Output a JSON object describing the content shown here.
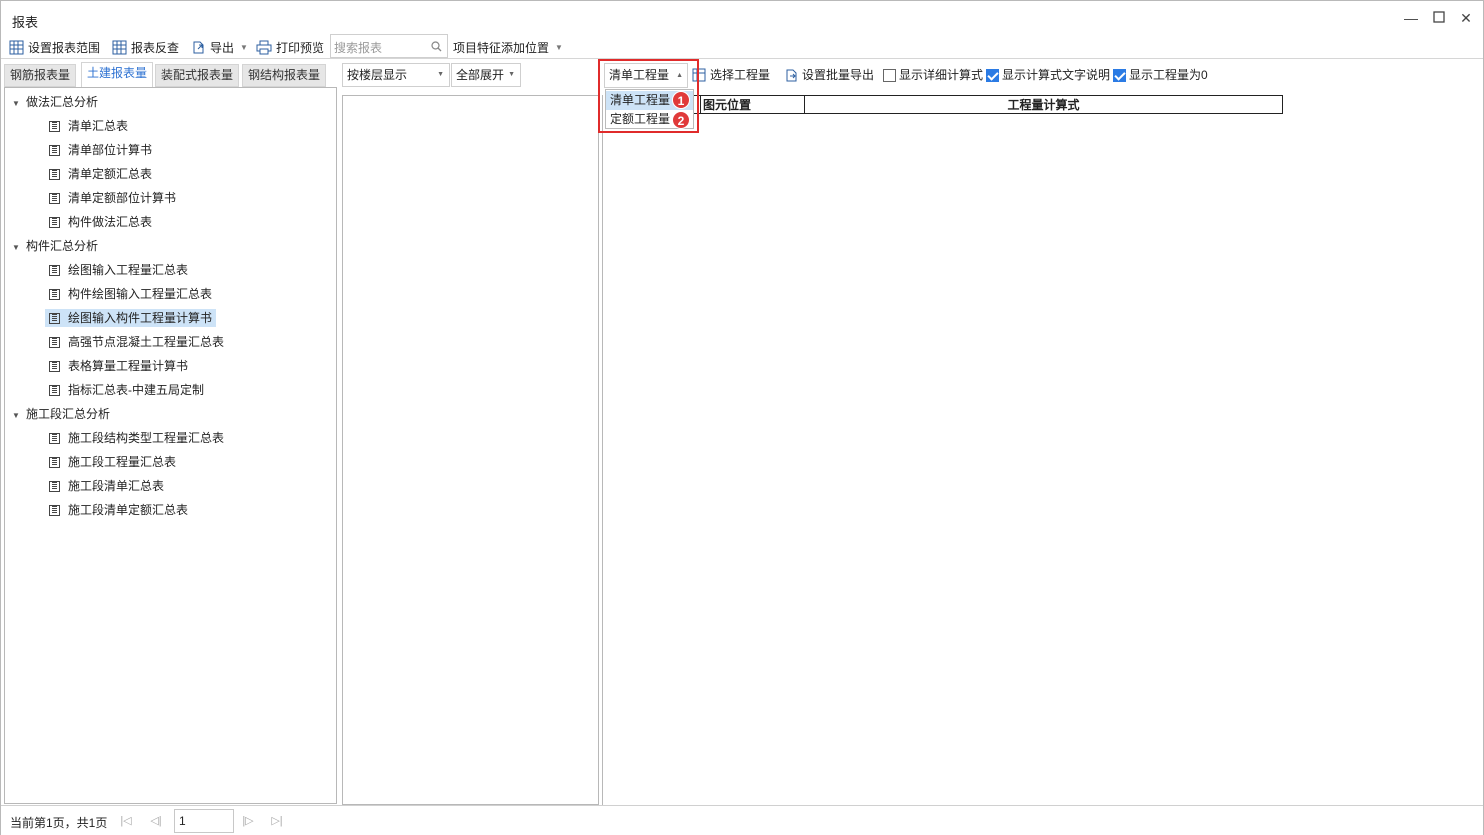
{
  "window": {
    "title": "报表"
  },
  "toolbar": {
    "set_range": "设置报表范围",
    "reverse_check": "报表反查",
    "export": "导出",
    "print_preview": "打印预览",
    "search_placeholder": "搜索报表",
    "add_position": "项目特征添加位置"
  },
  "tabs": [
    {
      "label": "钢筋报表量"
    },
    {
      "label": "土建报表量"
    },
    {
      "label": "装配式报表量"
    },
    {
      "label": "钢结构报表量"
    }
  ],
  "tree": {
    "groups": [
      {
        "label": "做法汇总分析",
        "items": [
          "清单汇总表",
          "清单部位计算书",
          "清单定额汇总表",
          "清单定额部位计算书",
          "构件做法汇总表"
        ]
      },
      {
        "label": "构件汇总分析",
        "items": [
          "绘图输入工程量汇总表",
          "构件绘图输入工程量汇总表",
          "绘图输入构件工程量计算书",
          "高强节点混凝土工程量汇总表",
          "表格算量工程量计算书",
          "指标汇总表-中建五局定制"
        ]
      },
      {
        "label": "施工段汇总分析",
        "items": [
          "施工段结构类型工程量汇总表",
          "施工段工程量汇总表",
          "施工段清单汇总表",
          "施工段清单定额汇总表"
        ]
      }
    ],
    "selected": "绘图输入构件工程量计算书"
  },
  "middle": {
    "floor_display": "按楼层显示",
    "expand_all": "全部展开"
  },
  "right_toolbar": {
    "quantity_type": "清单工程量",
    "select_quantity": "选择工程量",
    "batch_export": "设置批量导出",
    "show_detail": "显示详细计算式",
    "show_text": "显示计算式文字说明",
    "show_zero": "显示工程量为0"
  },
  "checkboxes": {
    "show_detail": false,
    "show_text": true,
    "show_zero": true
  },
  "dropdown_options": [
    {
      "label": "清单工程量",
      "badge": "1"
    },
    {
      "label": "定额工程量",
      "badge": "2"
    }
  ],
  "table": {
    "col1": "图元位置",
    "col2": "工程量计算式"
  },
  "status": {
    "page_text": "当前第1页，共1页",
    "page_value": "1"
  }
}
